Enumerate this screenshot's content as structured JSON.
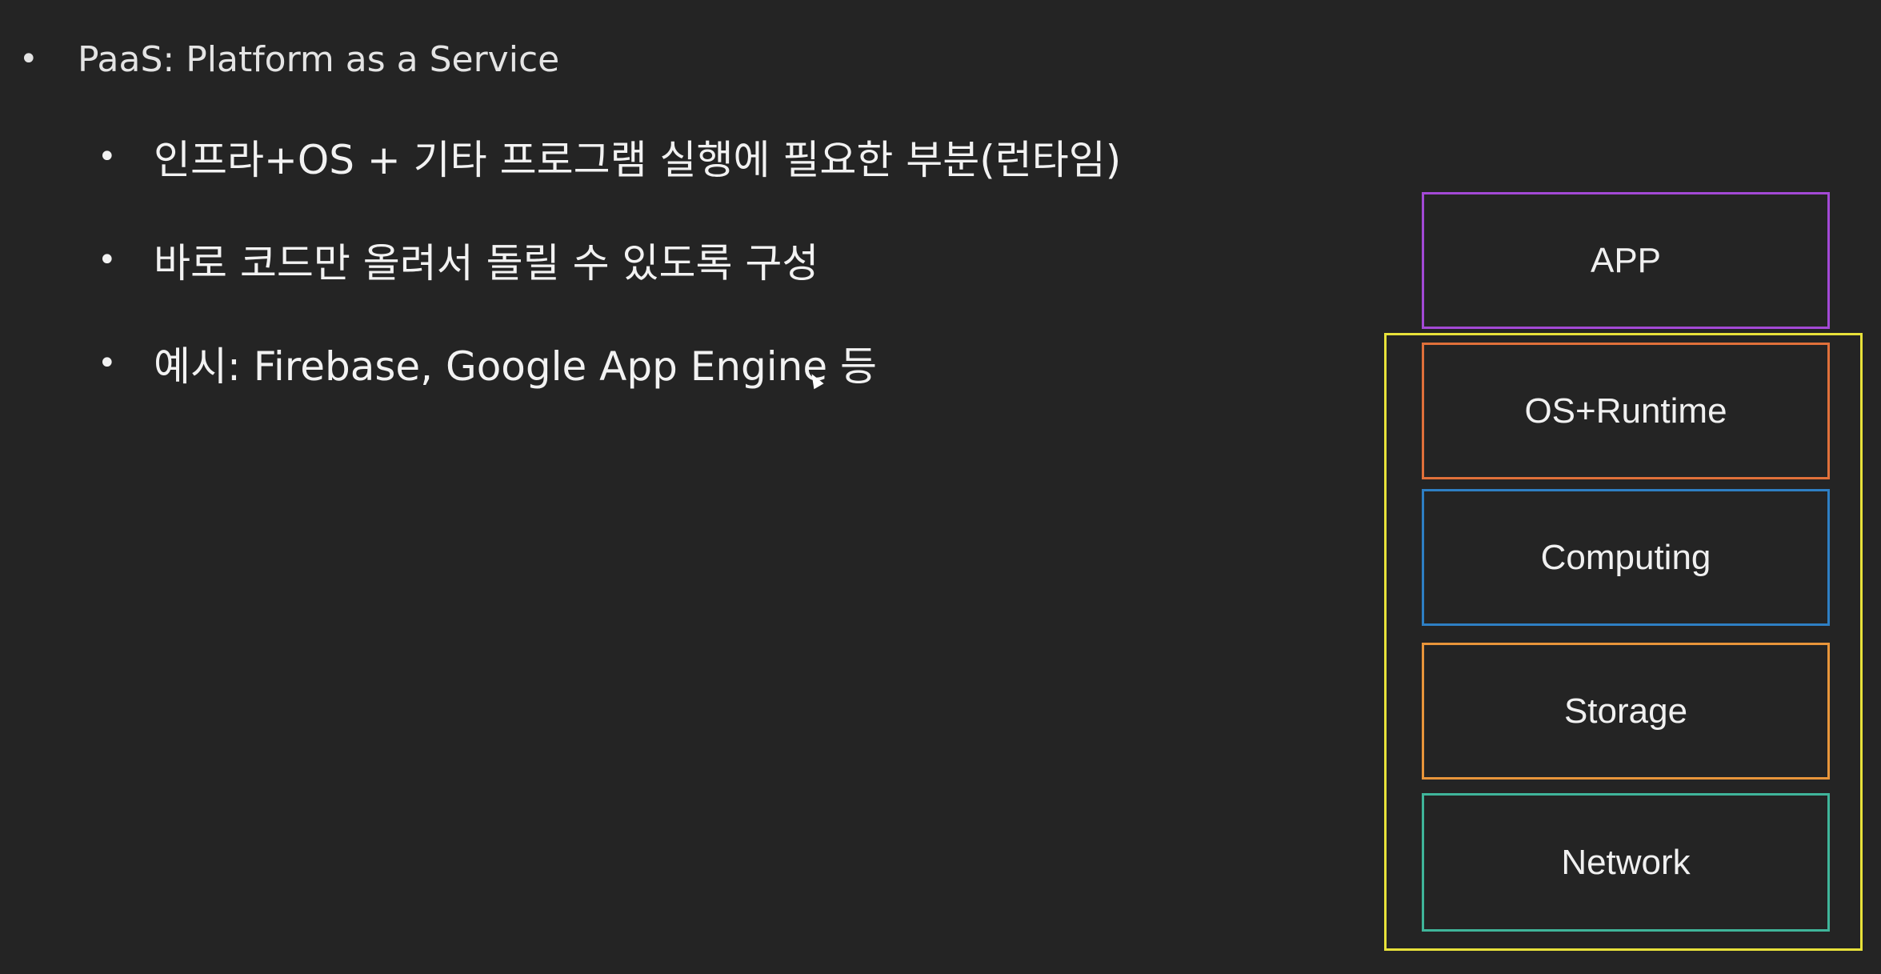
{
  "slide": {
    "bullet_char": "•",
    "heading": "PaaS: Platform as a Service",
    "points": [
      "인프라+OS + 기타 프로그램 실행에 필요한 부분(런타임)",
      "바로 코드만 올려서 돌릴 수 있도록 구성",
      "예시: Firebase, Google App Engine 등"
    ]
  },
  "stack": {
    "layers": [
      {
        "label": "APP",
        "color": "#a349d6"
      },
      {
        "label": "OS+Runtime",
        "color": "#e0703a"
      },
      {
        "label": "Computing",
        "color": "#2e7fc4"
      },
      {
        "label": "Storage",
        "color": "#e8953a"
      },
      {
        "label": "Network",
        "color": "#3fb59a"
      }
    ],
    "platform_frame_color": "#e7e13a"
  }
}
